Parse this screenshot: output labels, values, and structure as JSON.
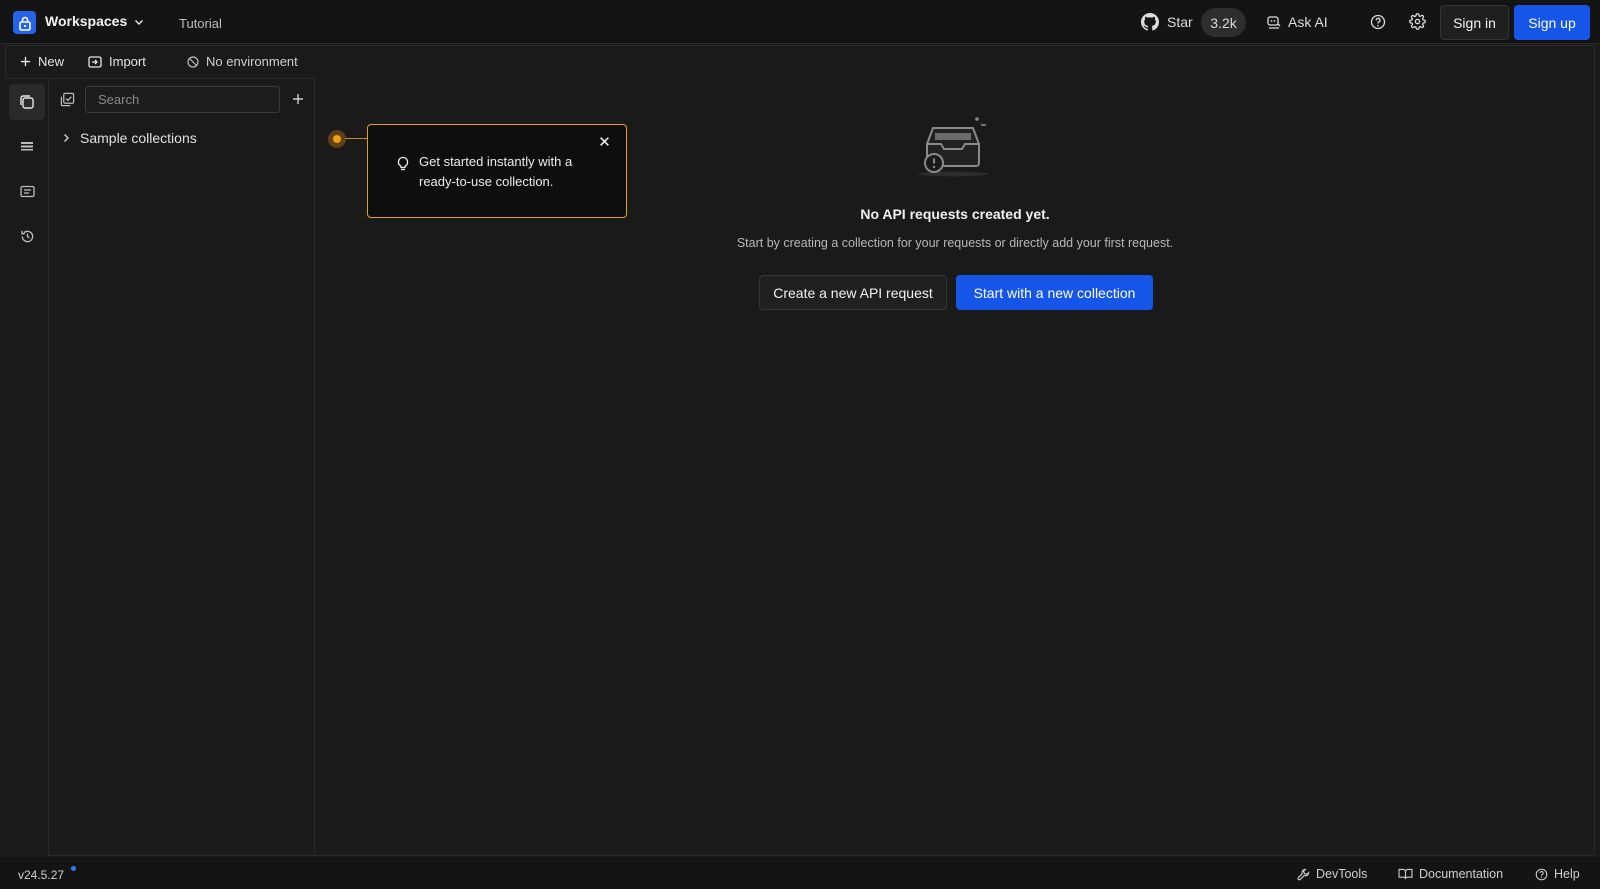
{
  "header": {
    "workspace_label": "Workspaces",
    "tutorial_label": "Tutorial",
    "star_label": "Star",
    "star_count": "3.2k",
    "ask_ai_label": "Ask AI",
    "sign_in_label": "Sign in",
    "sign_up_label": "Sign up"
  },
  "toolbar": {
    "new_label": "New",
    "import_label": "Import",
    "environment_label": "No environment"
  },
  "sidebar": {
    "search_placeholder": "Search",
    "collections": [
      {
        "label": "Sample collections"
      }
    ]
  },
  "popover": {
    "text": "Get started instantly with a ready-to-use collection."
  },
  "empty_state": {
    "title": "No API requests created yet.",
    "subtitle": "Start by creating a collection for your requests or directly add your first request.",
    "create_request_label": "Create a new API request",
    "start_collection_label": "Start with a new collection"
  },
  "footer": {
    "version": "v24.5.27",
    "devtools_label": "DevTools",
    "documentation_label": "Documentation",
    "help_label": "Help"
  },
  "colors": {
    "accent": "#1556e8",
    "highlight": "#f59e0b",
    "background": "#1a1a1a"
  }
}
